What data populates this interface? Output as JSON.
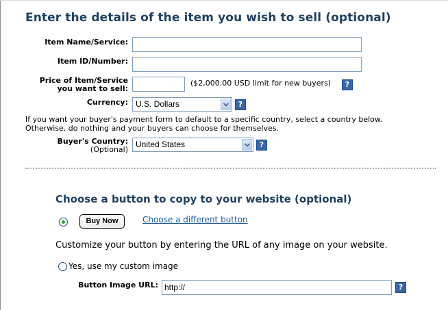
{
  "section1": {
    "title": "Enter the details of the item you wish to sell (optional)",
    "item_name": {
      "label": "Item Name/Service:",
      "value": ""
    },
    "item_id": {
      "label": "Item ID/Number:",
      "value": ""
    },
    "price": {
      "label_line1": "Price of Item/Service",
      "label_line2": "you want to sell:",
      "value": "",
      "note": "($2,000.00 USD limit for new buyers)"
    },
    "currency": {
      "label": "Currency:",
      "selected": "U.S. Dollars"
    },
    "country_info_line1": "If you want your buyer's payment form to default to a specific country, select a country below.",
    "country_info_line2": "Otherwise, do nothing and your buyers can choose for themselves.",
    "buyer_country": {
      "label": "Buyer's Country:",
      "optional": "(Optional)",
      "selected": "United States"
    },
    "help_glyph": "?"
  },
  "section2": {
    "title": "Choose a button to copy to your website (optional)",
    "button_preview_label": "Buy Now",
    "choose_link": "Choose a different button",
    "customize_text": "Customize your button by entering the URL of any image on your website.",
    "custom_image_radio_label": "Yes, use my custom image",
    "image_url": {
      "label": "Button Image URL:",
      "value": "http://"
    }
  },
  "colors": {
    "heading": "#1f3f5f",
    "link": "#1f5a9c",
    "help_bg": "#3a66a8",
    "radio_dot": "#21a121"
  }
}
